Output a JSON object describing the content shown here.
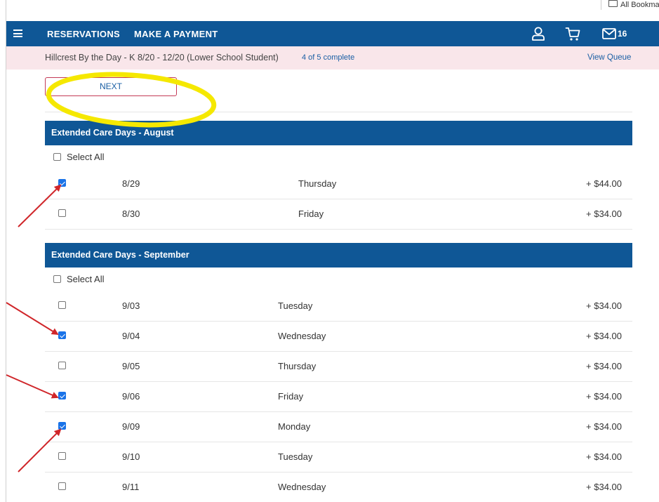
{
  "bookmarks_bar": {
    "all_bookmarks_label": "All Bookmarks"
  },
  "nav": {
    "reservations_label": "RESERVATIONS",
    "make_payment_label": "MAKE A PAYMENT",
    "mail_count": "16"
  },
  "status": {
    "program": "Hillcrest By the Day - K 8/20 - 12/20  (Lower School Student)",
    "progress": "4 of 5 complete",
    "view_queue_label": "View Queue"
  },
  "next_button_label": "NEXT",
  "sections": [
    {
      "title": "Extended Care Days - August",
      "select_all_label": "Select All",
      "select_all_checked": false,
      "rows": [
        {
          "date": "8/29",
          "day": "Thursday",
          "price": "+ $44.00",
          "checked": true
        },
        {
          "date": "8/30",
          "day": "Friday",
          "price": "+ $34.00",
          "checked": false
        }
      ]
    },
    {
      "title": "Extended Care Days - September",
      "select_all_label": "Select All",
      "select_all_checked": false,
      "rows": [
        {
          "date": "9/03",
          "day": "Tuesday",
          "price": "+ $34.00",
          "checked": false
        },
        {
          "date": "9/04",
          "day": "Wednesday",
          "price": "+ $34.00",
          "checked": true
        },
        {
          "date": "9/05",
          "day": "Thursday",
          "price": "+ $34.00",
          "checked": false
        },
        {
          "date": "9/06",
          "day": "Friday",
          "price": "+ $34.00",
          "checked": true
        },
        {
          "date": "9/09",
          "day": "Monday",
          "price": "+ $34.00",
          "checked": true
        },
        {
          "date": "9/10",
          "day": "Tuesday",
          "price": "+ $34.00",
          "checked": false
        },
        {
          "date": "9/11",
          "day": "Wednesday",
          "price": "+ $34.00",
          "checked": false
        }
      ]
    }
  ],
  "colors": {
    "nav_blue": "#0f5796",
    "status_pink": "#f9e6ea",
    "link_blue": "#1a5fa4",
    "checkbox_blue": "#1a73e8",
    "highlight_yellow": "#f5e800",
    "annotation_red": "#d0262a"
  },
  "annotations": {
    "ellipse": "highlight-ellipse",
    "arrows": 4
  }
}
